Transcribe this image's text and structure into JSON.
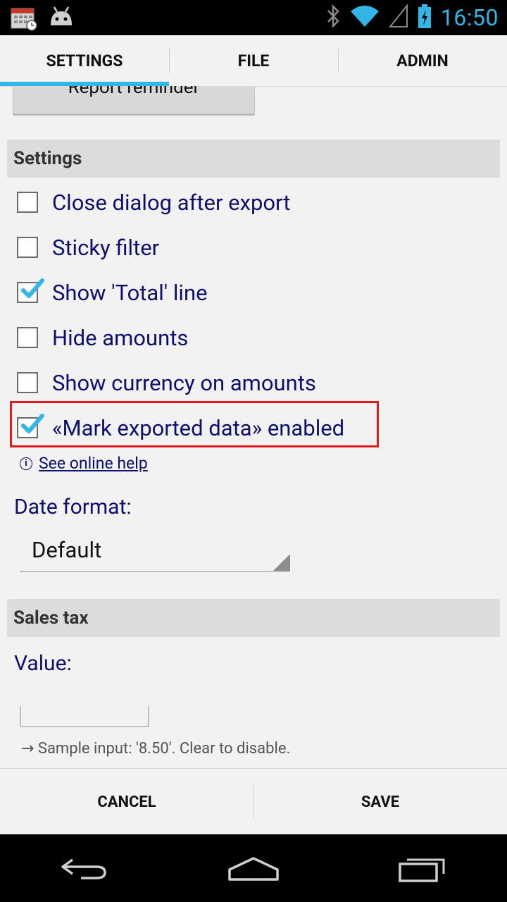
{
  "status_bar": {
    "time": "16:50",
    "left_icons": [
      "calendar-icon",
      "android-icon"
    ],
    "right_icons": [
      "bluetooth-icon",
      "wifi-icon",
      "signal-icon",
      "battery-charging-icon"
    ]
  },
  "tabs": [
    {
      "label": "SETTINGS",
      "active": true
    },
    {
      "label": "FILE",
      "active": false
    },
    {
      "label": "ADMIN",
      "active": false
    }
  ],
  "report_button": {
    "label": "Report reminder"
  },
  "settings_section": {
    "header": "Settings"
  },
  "checkboxes": [
    {
      "label": "Close dialog after export",
      "checked": false
    },
    {
      "label": "Sticky filter",
      "checked": false
    },
    {
      "label": "Show 'Total' line",
      "checked": true
    },
    {
      "label": "Hide amounts",
      "checked": false
    },
    {
      "label": "Show currency on amounts",
      "checked": false
    },
    {
      "label": "«Mark exported data» enabled",
      "checked": true
    }
  ],
  "help_link": {
    "icon": "info-icon",
    "label": "See online help"
  },
  "date_format": {
    "label": "Date format:",
    "selected": "Default"
  },
  "sales_tax": {
    "header": "Sales tax",
    "value_label": "Value:",
    "value": "",
    "hint": "Sample input: '8.50'. Clear to disable.",
    "hint_icon": "arrow-right-icon"
  },
  "bottom_bar": {
    "cancel_label": "CANCEL",
    "save_label": "SAVE"
  },
  "nav_bar": {
    "icons": [
      "back-icon",
      "home-icon",
      "recent-apps-icon"
    ]
  },
  "colors": {
    "accent": "#33b5e5",
    "text_blue": "#0d0f6e",
    "highlight_red": "#e0191f",
    "section_bg": "#dcdcdc",
    "background": "#f2f2f2"
  }
}
